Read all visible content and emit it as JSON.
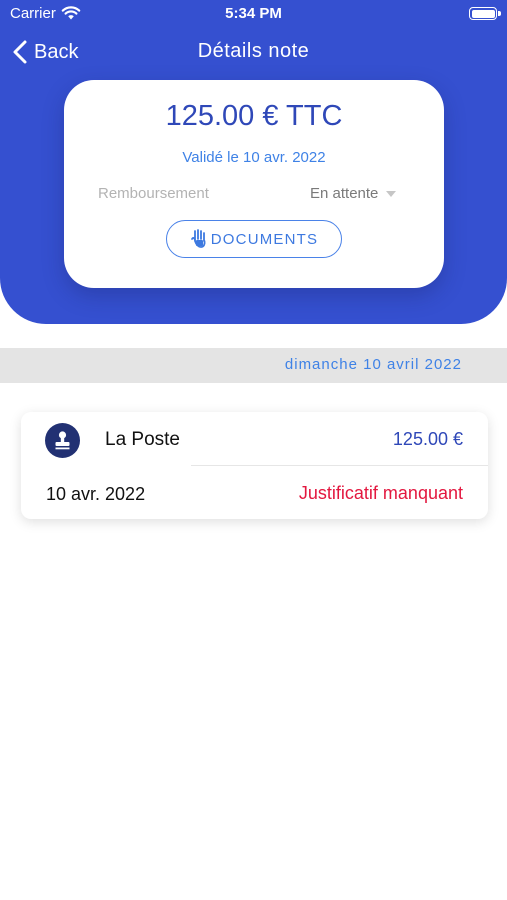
{
  "status_bar": {
    "carrier": "Carrier",
    "time": "5:34 PM",
    "wifi_icon": "wifi-icon",
    "battery_icon": "battery-icon"
  },
  "nav": {
    "back_label": "Back",
    "back_icon": "chevron-left-icon",
    "title": "Détails note"
  },
  "summary": {
    "amount": "125.00 € TTC",
    "validated": "Validé le 10 avr. 2022",
    "reimbursement_label": "Remboursement",
    "reimbursement_status": "En attente",
    "status_caret_icon": "caret-down-icon",
    "documents_label": "DOCUMENTS",
    "documents_icon": "document-icon"
  },
  "section": {
    "date": "dimanche 10 avril 2022"
  },
  "expenses": [
    {
      "merchant": "La Poste",
      "icon": "stamp-icon",
      "amount": "125.00 €",
      "date": "10 avr. 2022",
      "status": "Justificatif manquant"
    }
  ],
  "colors": {
    "primary": "#3550d0",
    "amount_text": "#2f48b8",
    "accent_blue": "#3f82e6",
    "avatar_bg": "#223173",
    "error_red": "#e3173f",
    "section_band": "#e4e4e4"
  }
}
